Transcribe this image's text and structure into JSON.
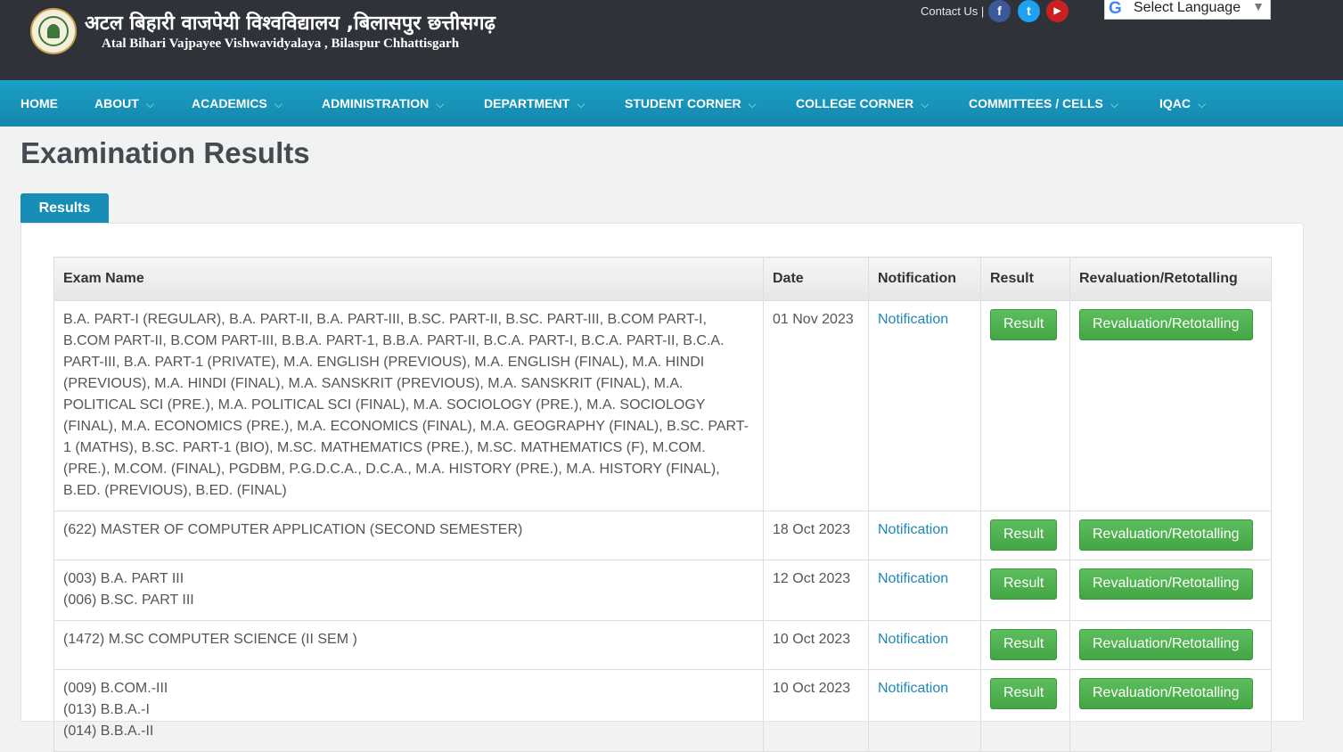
{
  "header": {
    "title_hindi": "अटल बिहारी वाजपेयी विश्वविद्यालय ,बिलासपुर छत्तीसगढ़",
    "title_english": "Atal Bihari Vajpayee Vishwavidyalaya , Bilaspur Chhattisgarh",
    "contact_label": "Contact Us |",
    "social": [
      "facebook-icon",
      "twitter-icon",
      "youtube-icon"
    ],
    "language_select": "Select Language"
  },
  "nav": {
    "items": [
      {
        "label": "HOME",
        "dropdown": false
      },
      {
        "label": "ABOUT",
        "dropdown": true
      },
      {
        "label": "ACADEMICS",
        "dropdown": true
      },
      {
        "label": "ADMINISTRATION",
        "dropdown": true
      },
      {
        "label": "DEPARTMENT",
        "dropdown": true
      },
      {
        "label": "STUDENT CORNER",
        "dropdown": true
      },
      {
        "label": "COLLEGE CORNER",
        "dropdown": true
      },
      {
        "label": "COMMITTEES / CELLS",
        "dropdown": true
      },
      {
        "label": "IQAC",
        "dropdown": true
      }
    ]
  },
  "page": {
    "title": "Examination Results",
    "tab_label": "Results"
  },
  "table": {
    "headers": [
      "Exam Name",
      "Date",
      "Notification",
      "Result",
      "Revaluation/Retotalling"
    ],
    "rows": [
      {
        "exam": "B.A. PART-I (REGULAR), B.A. PART-II, B.A. PART-III, B.SC. PART-II, B.SC. PART-III, B.COM PART-I, B.COM PART-II, B.COM PART-III, B.B.A. PART-1, B.B.A. PART-II, B.C.A. PART-I, B.C.A. PART-II, B.C.A. PART-III, B.A. PART-1 (PRIVATE), M.A. ENGLISH (PREVIOUS), M.A. ENGLISH (FINAL), M.A. HINDI (PREVIOUS), M.A. HINDI (FINAL), M.A. SANSKRIT (PREVIOUS), M.A. SANSKRIT (FINAL), M.A. POLITICAL SCI (PRE.), M.A. POLITICAL SCI (FINAL), M.A. SOCIOLOGY (PRE.), M.A. SOCIOLOGY (FINAL), M.A. ECONOMICS (PRE.), M.A. ECONOMICS (FINAL), M.A. GEOGRAPHY (FINAL), B.SC. PART-1 (MATHS), B.SC. PART-1 (BIO), M.SC. MATHEMATICS (PRE.), M.SC. MATHEMATICS (F), M.COM. (PRE.), M.COM. (FINAL), PGDBM, P.G.D.C.A., D.C.A., M.A. HISTORY (PRE.), M.A. HISTORY (FINAL), B.ED. (PREVIOUS), B.ED. (FINAL)",
        "date": "01 Nov 2023",
        "notification": "Notification",
        "result": "Result",
        "revaluation": "Revaluation/Retotalling"
      },
      {
        "exam": "(622) MASTER OF COMPUTER APPLICATION (SECOND SEMESTER)",
        "date": "18 Oct 2023",
        "notification": "Notification",
        "result": "Result",
        "revaluation": "Revaluation/Retotalling"
      },
      {
        "exam_lines": [
          "(003) B.A. PART III",
          "(006) B.SC. PART III"
        ],
        "date": "12 Oct 2023",
        "notification": "Notification",
        "result": "Result",
        "revaluation": "Revaluation/Retotalling"
      },
      {
        "exam": "(1472) M.SC COMPUTER SCIENCE (II SEM )",
        "date": "10 Oct 2023",
        "notification": "Notification",
        "result": "Result",
        "revaluation": "Revaluation/Retotalling"
      },
      {
        "exam_lines": [
          "(009) B.COM.-III",
          "(013) B.B.A.-I",
          "(014) B.B.A.-II"
        ],
        "date": "10 Oct 2023",
        "notification": "Notification",
        "result": "Result",
        "revaluation": "Revaluation/Retotalling"
      }
    ]
  }
}
